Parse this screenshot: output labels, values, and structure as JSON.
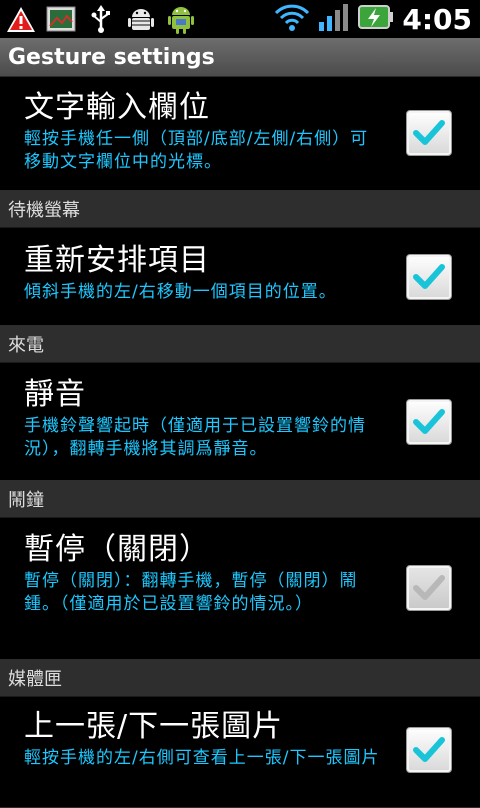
{
  "status_bar": {
    "time": "4:05",
    "icons": [
      "warning-icon",
      "gallery-icon",
      "usb-icon",
      "android-debug-icon",
      "android-icon",
      "wifi-icon",
      "signal-icon",
      "battery-charging-icon"
    ]
  },
  "title_bar": {
    "title": "Gesture settings"
  },
  "items": [
    {
      "title": "文字輸入欄位",
      "summary": "輕按手機任一側（頂部/底部/左側/右側）可移動文字欄位中的光標。",
      "checked": true
    }
  ],
  "sections": [
    {
      "header": "待機螢幕",
      "items": [
        {
          "title": "重新安排項目",
          "summary": "傾斜手機的左/右移動一個項目的位置。",
          "checked": true
        }
      ]
    },
    {
      "header": "來電",
      "items": [
        {
          "title": "靜音",
          "summary": "手機鈴聲響起時（僅適用于已設置響鈴的情況），翻轉手機將其調爲靜音。",
          "checked": true
        }
      ]
    },
    {
      "header": "鬧鐘",
      "items": [
        {
          "title": "暫停（關閉）",
          "summary": "暫停（關閉）：翻轉手機，暫停（關閉）鬧鍾。（僅適用於已設置響鈴的情況。）",
          "checked": true,
          "enabled": false
        }
      ]
    },
    {
      "header": "媒體匣",
      "items": [
        {
          "title": "上一張/下一張圖片",
          "summary": "輕按手機的左/右側可查看上一張/下一張圖片",
          "checked": true
        }
      ]
    }
  ],
  "colors": {
    "summary_text": "#1ec8ff",
    "check_mark": "#19c4d9",
    "category_bg": "#2e2e2e",
    "title_bar_bg": "#5a5a5a"
  }
}
